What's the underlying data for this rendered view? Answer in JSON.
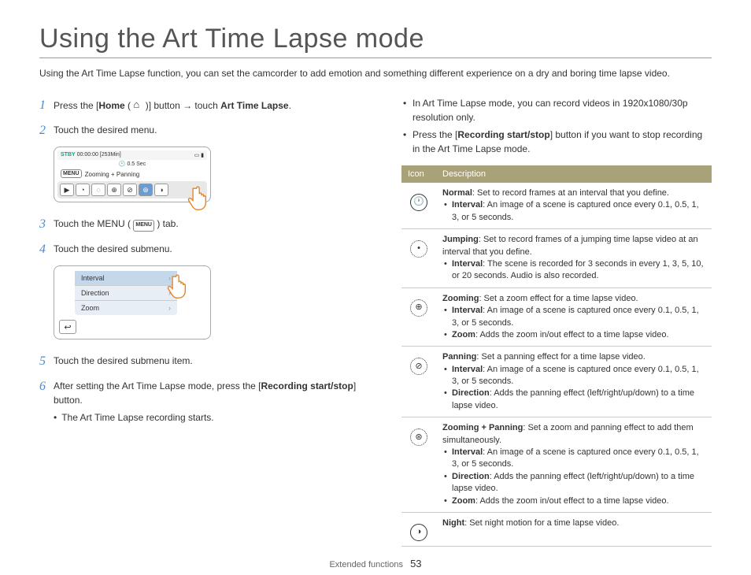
{
  "title": "Using the Art Time Lapse mode",
  "intro": "Using the Art Time Lapse function, you can set the camcorder to add emotion and something different experience on a dry and boring time lapse video.",
  "steps": {
    "s1a": "Press the [",
    "s1_home": "Home",
    "s1b": " ( ",
    "s1c": " )] button ",
    "s1_arrow": "→",
    "s1d": " touch ",
    "s1_atl": "Art Time Lapse",
    "s1e": ".",
    "s2": "Touch the desired menu.",
    "s3a": "Touch the MENU ( ",
    "s3_menu": "MENU",
    "s3b": " ) tab.",
    "s4": "Touch the desired submenu.",
    "s5": "Touch the desired submenu item.",
    "s6a": "After setting the Art Time Lapse mode, press the [",
    "s6_rec": "Recording start/stop",
    "s6b": "] button.",
    "s6_sub": "The Art Time Lapse recording starts."
  },
  "cam": {
    "stby": "STBY",
    "time": "00:00:00 [253Min]",
    "sec": "0.5 Sec",
    "menu": "MENU",
    "mode": "Zooming + Panning"
  },
  "submenu": {
    "i1": "Interval",
    "i2": "Direction",
    "i3": "Zoom"
  },
  "right": {
    "b1": "In Art Time Lapse mode, you can record videos in 1920x1080/30p resolution only.",
    "b2a": "Press the [",
    "b2_rec": "Recording start/stop",
    "b2b": "] button if you want to stop recording in the Art Time Lapse mode."
  },
  "table": {
    "h1": "Icon",
    "h2": "Description",
    "normal": {
      "title": "Normal",
      "def": ": Set to record frames at an interval that you define.",
      "int_l": "Interval",
      "int": ": An image of a scene is captured once every 0.1, 0.5, 1, 3, or 5 seconds."
    },
    "jumping": {
      "title": "Jumping",
      "def": ": Set to record frames of a jumping time lapse video at an interval that you define.",
      "int_l": "Interval",
      "int": ": The scene is recorded for 3 seconds in every 1, 3, 5, 10, or 20 seconds. Audio is also recorded."
    },
    "zooming": {
      "title": "Zooming",
      "def": ": Set a zoom effect for a time lapse video.",
      "int_l": "Interval",
      "int": ": An image of a scene is captured once every 0.1, 0.5, 1, 3, or 5 seconds.",
      "zoom_l": "Zoom",
      "zoom": ": Adds the zoom in/out effect to a time lapse video."
    },
    "panning": {
      "title": "Panning",
      "def": ": Set a panning effect for a time lapse video.",
      "int_l": "Interval",
      "int": ": An image of a scene is captured once every 0.1, 0.5, 1, 3, or 5 seconds.",
      "dir_l": "Direction",
      "dir": ": Adds the panning effect (left/right/up/down) to a time lapse video."
    },
    "zp": {
      "title": "Zooming + Panning",
      "def": ": Set a zoom and panning effect to add them simultaneously.",
      "int_l": "Interval",
      "int": ": An image of a scene is captured once every 0.1, 0.5, 1, 3, or 5 seconds.",
      "dir_l": "Direction",
      "dir": ": Adds the panning effect (left/right/up/down) to a time lapse video.",
      "zoom_l": "Zoom",
      "zoom": ": Adds the zoom in/out effect to a time lapse video."
    },
    "night": {
      "title": "Night",
      "def": ": Set night motion for a time lapse video."
    }
  },
  "footer": {
    "section": "Extended functions",
    "page": "53"
  }
}
